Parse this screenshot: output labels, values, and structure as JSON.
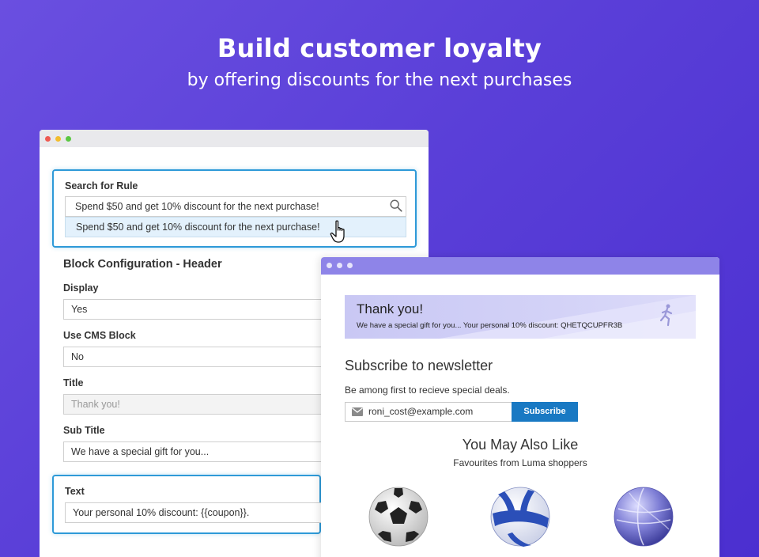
{
  "hero": {
    "title": "Build customer loyalty",
    "subtitle": "by offering discounts for the next purchases"
  },
  "admin": {
    "search": {
      "label": "Search for Rule",
      "value": "Spend $50 and get 10% discount for the next purchase!",
      "suggestion": "Spend $50 and get 10% discount for the next purchase!"
    },
    "section_title": "Block Configuration - Header",
    "display": {
      "label": "Display",
      "value": "Yes"
    },
    "use_cms_block": {
      "label": "Use CMS Block",
      "value": "No"
    },
    "title_field": {
      "label": "Title",
      "placeholder": "Thank you!"
    },
    "subtitle_field": {
      "label": "Sub Title",
      "value": "We have a special gift for you..."
    },
    "text_field": {
      "label": "Text",
      "value": "Your personal 10% discount: {{coupon}}."
    }
  },
  "store": {
    "banner": {
      "title": "Thank you!",
      "text": "We have a special gift for you... Your personal 10% discount: QHETQCUPFR3B"
    },
    "newsletter": {
      "title": "Subscribe to newsletter",
      "description": "Be among first to recieve special deals.",
      "email_value": "roni_cost@example.com",
      "subscribe_label": "Subscribe"
    },
    "recommendations": {
      "title": "You May Also Like",
      "subtitle": "Favourites from Luma shoppers",
      "products": [
        "soccer-ball",
        "volleyball-blue-white",
        "volleyball-purple"
      ]
    }
  },
  "colors": {
    "background": "#5a3fd8",
    "accent": "#2e9ad8",
    "subscribe_button": "#1979c3",
    "store_titlebar": "#8e84e8"
  }
}
